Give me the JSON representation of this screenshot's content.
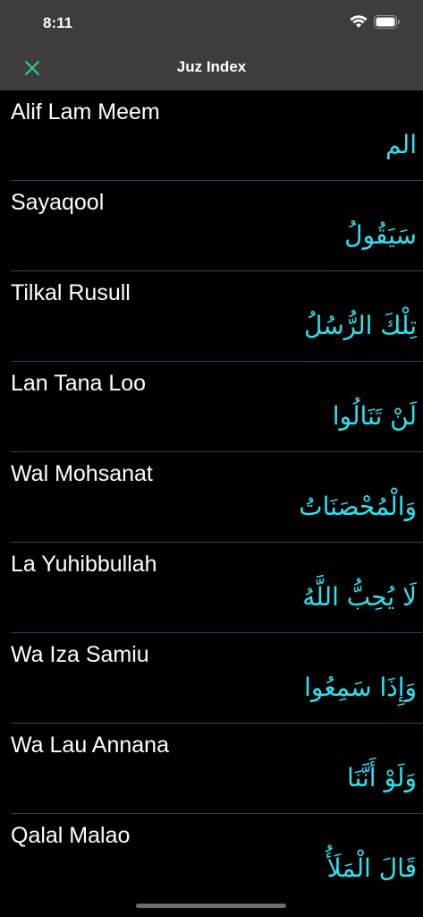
{
  "status_bar": {
    "time": "8:11"
  },
  "nav": {
    "title": "Juz Index",
    "close_icon": "close-x-icon",
    "accent_color": "#2ecc71"
  },
  "juz_list": [
    {
      "name": "Alif Lam Meem",
      "arabic": "الم"
    },
    {
      "name": "Sayaqool",
      "arabic": "سَيَقُولُ"
    },
    {
      "name": "Tilkal Rusull",
      "arabic": "تِلْكَ الرُّسُلُ"
    },
    {
      "name": "Lan Tana Loo",
      "arabic": "لَنْ تَنَالُوا"
    },
    {
      "name": "Wal Mohsanat",
      "arabic": "وَالْمُحْصَنَاتُ"
    },
    {
      "name": "La Yuhibbullah",
      "arabic": "لَا يُحِبُّ اللَّهُ"
    },
    {
      "name": "Wa Iza Samiu",
      "arabic": "وَإِذَا سَمِعُوا"
    },
    {
      "name": "Wa Lau Annana",
      "arabic": "وَلَوْ أَنَّنَا"
    },
    {
      "name": "Qalal Malao",
      "arabic": "قَالَ الْمَلَأُ"
    }
  ],
  "colors": {
    "background": "#000000",
    "bar": "#3d3d3d",
    "arabic_text": "#2ee2f0",
    "divider": "#1d4a55"
  }
}
